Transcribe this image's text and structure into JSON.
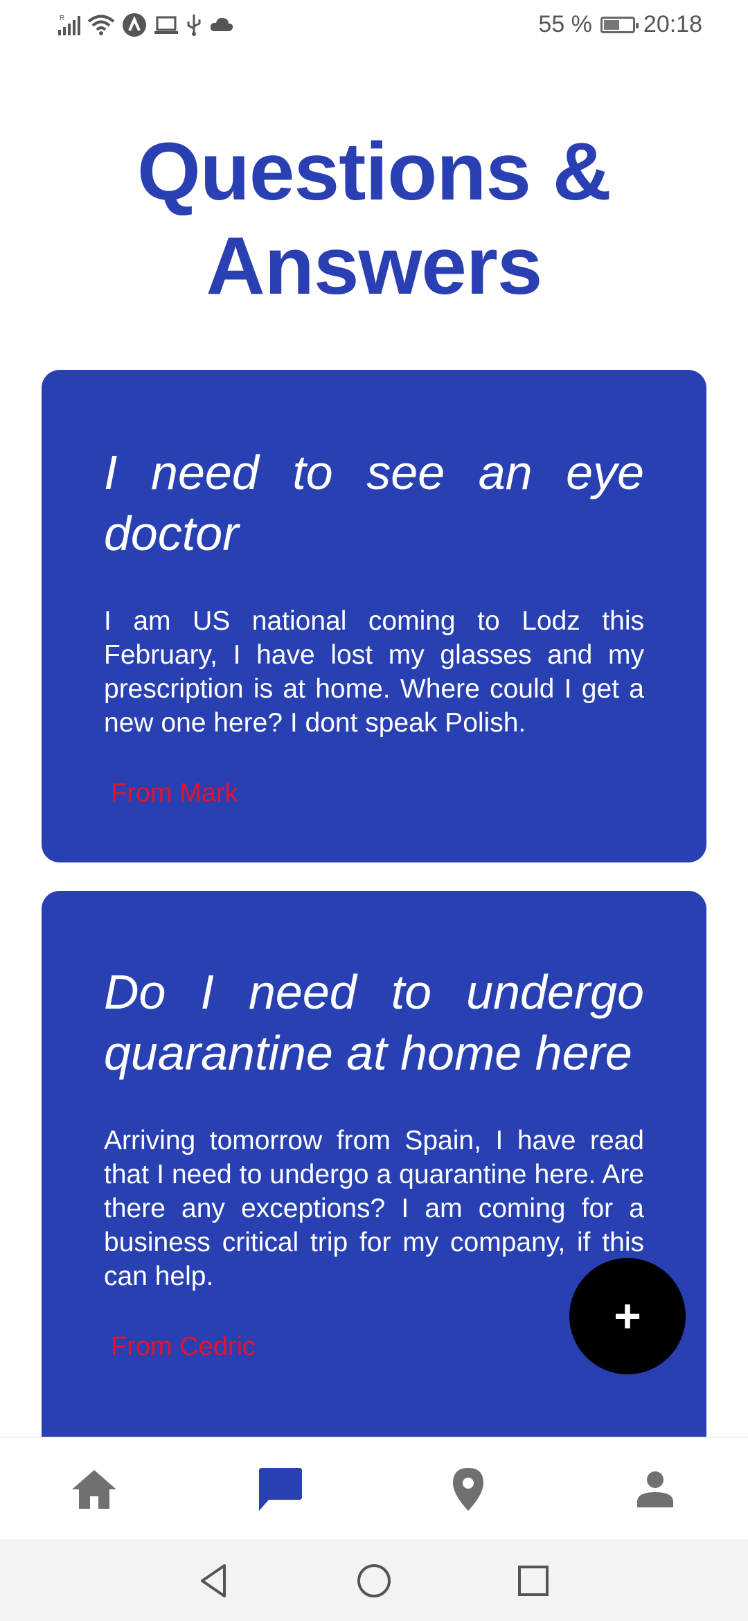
{
  "status_bar": {
    "battery_percent": "55 %",
    "battery_level": 0.55,
    "time": "20:18",
    "left_icons": [
      "signal-icon",
      "wifi-icon",
      "vpn-a-icon",
      "laptop-icon",
      "usb-icon",
      "cloud-icon"
    ],
    "signal_roaming_label": "R"
  },
  "page": {
    "title": "Questions & Answers"
  },
  "questions": [
    {
      "title": "I need to see an eye doctor",
      "body": "I am US national coming to Lodz this February, I have lost my glasses and my prescription is at home. Where could I get a new one here? I dont speak Polish.",
      "author": "From Mark"
    },
    {
      "title": "Do I need to undergo quarantine at home here",
      "body": "Arriving tomorrow from Spain, I have read that I need to undergo a quarantine here. Are there any exceptions? I am coming for a business critical trip for my company, if this can help.",
      "author": "From Cedric"
    }
  ],
  "fab": {
    "label": "+"
  },
  "bottom_nav": {
    "items": [
      {
        "icon": "home-icon",
        "active": false
      },
      {
        "icon": "chat-icon",
        "active": true
      },
      {
        "icon": "location-pin-icon",
        "active": false
      },
      {
        "icon": "person-icon",
        "active": false
      }
    ]
  },
  "system_nav": {
    "buttons": [
      "back-icon",
      "home-circle-icon",
      "recents-icon"
    ]
  },
  "colors": {
    "accent": "#2840b1",
    "title": "#2a40b2",
    "author": "#e8112d",
    "nav_active": "#2840b1",
    "nav_inactive": "#707070",
    "fab": "#000000"
  }
}
